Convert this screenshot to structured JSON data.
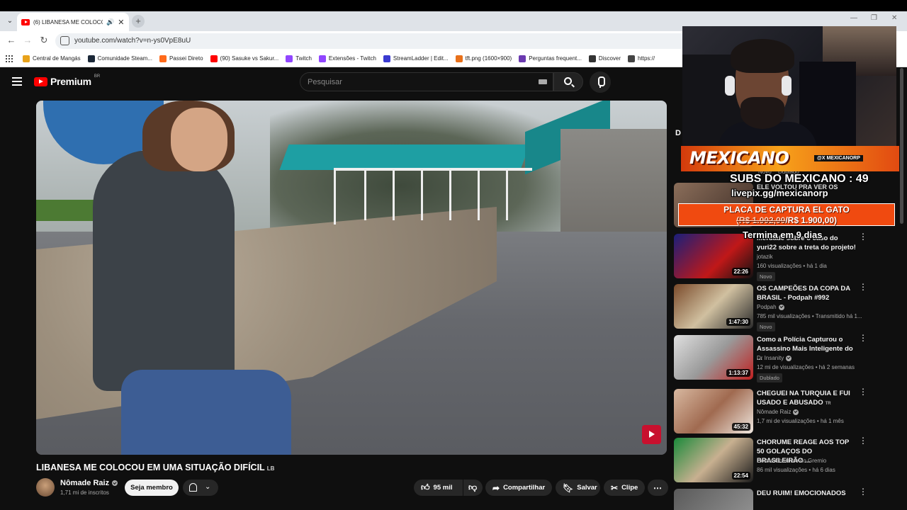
{
  "browser": {
    "tab_title": "(6) LIBANESA ME COLOCOU",
    "url": "youtube.com/watch?v=n-ys0VpE8uU",
    "bookmarks": [
      {
        "label": "Central de Mangás",
        "color": "#e8a21a"
      },
      {
        "label": "Comunidade Steam...",
        "color": "#1b2838"
      },
      {
        "label": "Passei Direto",
        "color": "#ff6a1a"
      },
      {
        "label": "(90) Sasuke vs Sakur...",
        "color": "#ff0000"
      },
      {
        "label": "Twitch",
        "color": "#9146ff"
      },
      {
        "label": "Extensões - Twitch",
        "color": "#9146ff"
      },
      {
        "label": "StreamLadder | Edit...",
        "color": "#3a3ad0"
      },
      {
        "label": "tft.png (1600×900)",
        "color": "#e8701a"
      },
      {
        "label": "Perguntas frequent...",
        "color": "#6b3ab0"
      },
      {
        "label": "Discover",
        "color": "#333333"
      },
      {
        "label": "https://",
        "color": "#444444"
      }
    ]
  },
  "youtube": {
    "logo_text": "Premium",
    "logo_country": "BR",
    "search_placeholder": "Pesquisar"
  },
  "video": {
    "title": "LIBANESA ME COLOCOU EM UMA SITUAÇÃO DIFÍCIL",
    "title_suffix": "LB",
    "channel": "Nômade Raiz",
    "subscribers": "1,71 mi de inscritos",
    "member_label": "Seja membro",
    "likes": "95 mil",
    "share_label": "Compartilhar",
    "save_label": "Salvar",
    "clip_label": "Clipe"
  },
  "overlay": {
    "streamer_name": "MEXICANO",
    "handle": "@X MEXICANORP",
    "subs_goal": "SUBS DO MEXICANO : 49",
    "pix": "livepix.gg/mexicanorp",
    "capture_line1": "PLACA DE CAPTURA EL GATO",
    "capture_old": "(R$ 1.002,00",
    "capture_new": "/R$ 1.900,00)",
    "ends_in": "Termina em 9 dias",
    "partial_letter": "D",
    "partial_badges": [
      "Novo",
      "Dublado"
    ],
    "partial_title": "ELE VOLTOU PRA VER OS"
  },
  "recommendations": [
    {
      "title": "...erdade sobre o caso do yuri22 sobre a treta do projeto!",
      "channel": "jotazik",
      "verified": false,
      "meta": "160 visualizações • há 1 dia",
      "badge": "Novo",
      "duration": "22:26",
      "thumb": "linear-gradient(135deg,#1a1f7a 0%,#c01818 60%,#111 100%)"
    },
    {
      "title": "OS CAMPEÕES DA COPA DA BRASIL - Podpah #992",
      "channel": "Podpah",
      "verified": true,
      "meta": "785 mil visualizações • Transmitido há 1...",
      "badge": "Novo",
      "duration": "1:47:30",
      "thumb": "linear-gradient(135deg,#7a4a2a 0%,#d0c0a0 50%,#2a2a2a 100%)"
    },
    {
      "title": "Como a Polícia Capturou o Assassino Mais Inteligente do ...",
      "channel": "Dr Insanity",
      "verified": true,
      "meta": "12 mi de visualizações • há 2 semanas",
      "badge": "Dublado",
      "duration": "1:13:37",
      "thumb": "linear-gradient(135deg,#e0e0e0 0%,#9a9a9a 50%,#c02020 100%)"
    },
    {
      "title": "CHEGUEI NA TURQUIA E FUI USADO E ABUSADO",
      "title_suffix": "TR",
      "channel": "Nômade Raiz",
      "verified": true,
      "meta": "1,7 mi de visualizações • há 1 mês",
      "badge": "",
      "duration": "45:32",
      "thumb": "linear-gradient(135deg,#d8b8a0 0%,#a06a50 50%,#f0e8e0 100%)"
    },
    {
      "title": "CHORUME REAGE AOS TOP 50 GOLAÇOS DO BRASILEIRÃO ...",
      "channel": "Cortes Chorume do Gremio",
      "verified": false,
      "meta": "86 mil visualizações • há 6 dias",
      "badge": "",
      "duration": "22:54",
      "thumb": "linear-gradient(135deg,#1a8a3a 0%,#c8b090 50%,#1a1a1a 100%)"
    },
    {
      "title": "DEU RUIM! EMOCIONADOS",
      "channel": "",
      "verified": false,
      "meta": "",
      "badge": "",
      "duration": "",
      "thumb": "linear-gradient(135deg,#5a5a5a 0%,#9a9a9a 100%)"
    }
  ]
}
